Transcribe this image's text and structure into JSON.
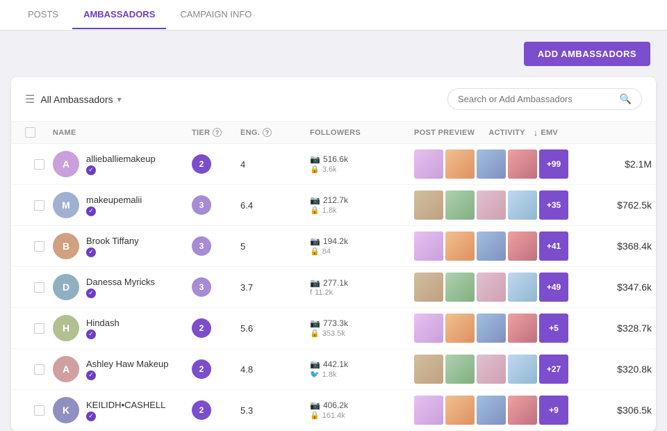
{
  "nav": {
    "tabs": [
      {
        "id": "posts",
        "label": "POSTS",
        "active": false
      },
      {
        "id": "ambassadors",
        "label": "AMBASSADORS",
        "active": true
      },
      {
        "id": "campaign-info",
        "label": "CAMPAIGN INFO",
        "active": false
      }
    ]
  },
  "header": {
    "add_button_label": "ADD AMBASSADORS"
  },
  "filter": {
    "selected": "All Ambassadors",
    "search_placeholder": "Search or Add Ambassadors"
  },
  "table": {
    "columns": {
      "name": "Name",
      "tier": "Tier",
      "eng": "Eng.",
      "followers": "Followers",
      "post_preview": "Post Preview",
      "activity": "Activity",
      "emv": "EMV"
    },
    "rows": [
      {
        "id": 1,
        "name": "allieballiemakeup",
        "tier": 2,
        "eng": "4",
        "followers_main": "516.6k",
        "followers_sub": "3.6k",
        "followers_sub_icon": "lock",
        "preview_colors": [
          "thumb-4",
          "thumb-2",
          "thumb-3",
          "thumb-5"
        ],
        "more_count": "+99",
        "emv": "$2.1M"
      },
      {
        "id": 2,
        "name": "makeupemalii",
        "tier": 3,
        "eng": "6.4",
        "followers_main": "212.7k",
        "followers_sub": "1.8k",
        "followers_sub_icon": "lock",
        "preview_colors": [
          "thumb-7",
          "thumb-1",
          "thumb-4",
          "thumb-3"
        ],
        "more_count": "+35",
        "emv": "$762.5k"
      },
      {
        "id": 3,
        "name": "Brook Tiffany",
        "tier": 3,
        "eng": "5",
        "followers_main": "194.2k",
        "followers_sub": "84",
        "followers_sub_icon": "lock",
        "preview_colors": [
          "thumb-1",
          "thumb-5",
          "thumb-6",
          "thumb-2"
        ],
        "more_count": "+41",
        "emv": "$368.4k"
      },
      {
        "id": 4,
        "name": "Danessa Myricks",
        "tier": 3,
        "eng": "3.7",
        "followers_main": "277.1k",
        "followers_sub": "11.2k",
        "followers_sub_icon": "facebook",
        "preview_colors": [
          "thumb-2",
          "thumb-6",
          "thumb-8",
          "thumb-4"
        ],
        "more_count": "+49",
        "emv": "$347.6k"
      },
      {
        "id": 5,
        "name": "Hindash",
        "tier": 2,
        "eng": "5.6",
        "followers_main": "773.3k",
        "followers_sub": "353.5k",
        "followers_sub_icon": "lock",
        "preview_colors": [
          "thumb-3",
          "thumb-7",
          "thumb-1",
          "thumb-5"
        ],
        "more_count": "+5",
        "emv": "$328.7k"
      },
      {
        "id": 6,
        "name": "Ashley Haw Makeup",
        "tier": 2,
        "eng": "4.8",
        "followers_main": "442.1k",
        "followers_sub": "1.8k",
        "followers_sub_icon": "twitter",
        "preview_colors": [
          "thumb-5",
          "thumb-8",
          "thumb-2",
          "thumb-6"
        ],
        "more_count": "+27",
        "emv": "$320.8k"
      },
      {
        "id": 7,
        "name": "KEILIDH•CASHELL",
        "tier": 2,
        "eng": "5.3",
        "followers_main": "406.2k",
        "followers_sub": "161.4k",
        "followers_sub_icon": "lock",
        "preview_colors": [
          "thumb-6",
          "thumb-4",
          "thumb-3",
          "thumb-7"
        ],
        "more_count": "+9",
        "emv": "$306.5k"
      }
    ]
  }
}
